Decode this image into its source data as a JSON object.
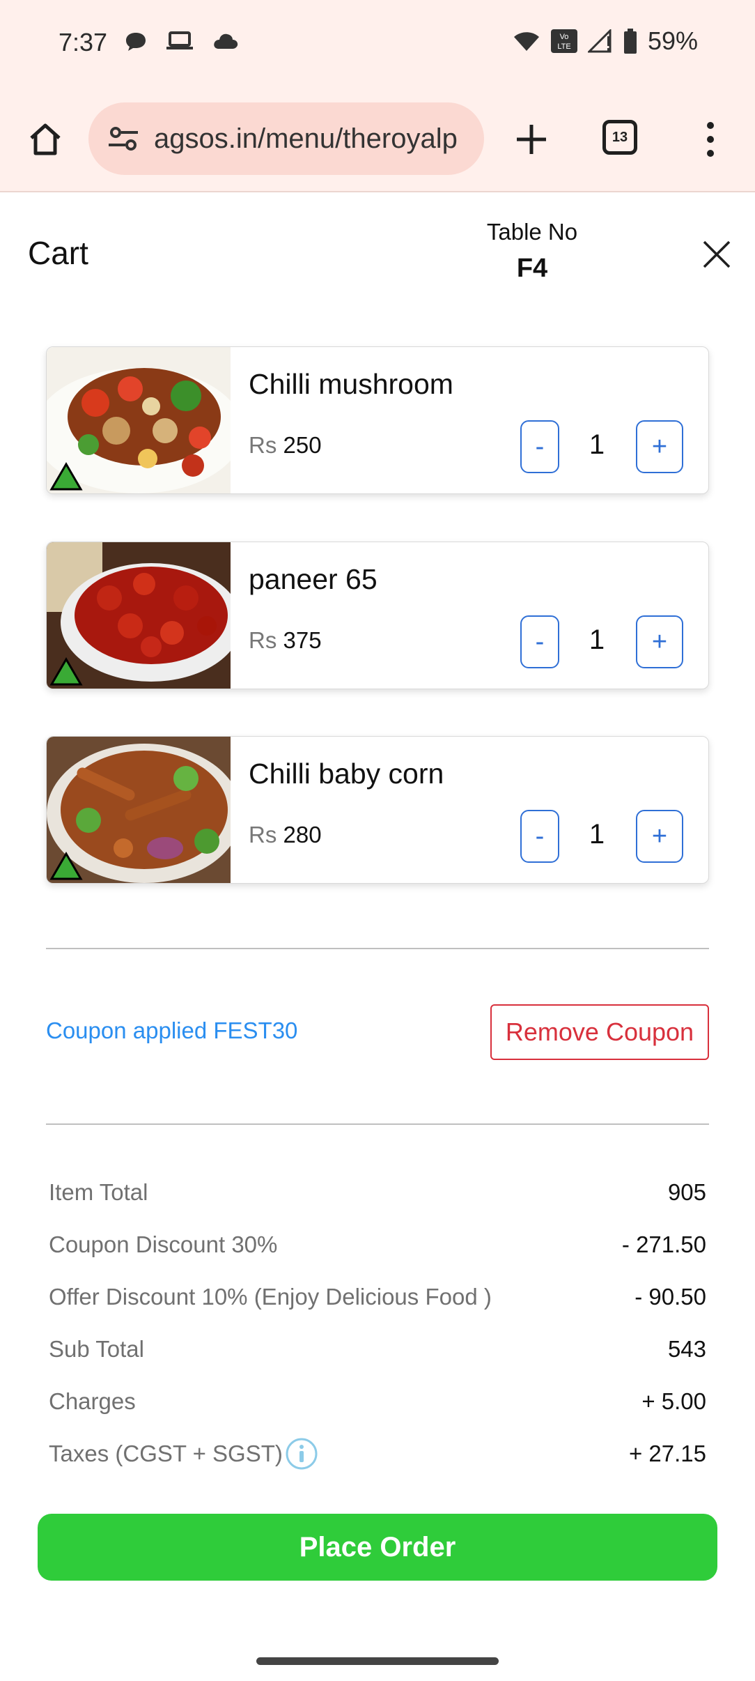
{
  "status_bar": {
    "time": "7:37",
    "left_icons": [
      "chat-bubble-icon",
      "laptop-icon",
      "cloud-icon"
    ],
    "right_icons": [
      "wifi-icon",
      "volte-icon",
      "signal-icon",
      "battery-icon"
    ],
    "battery": "59%"
  },
  "browser": {
    "url": "agsos.in/menu/theroyalp",
    "tab_count": "13"
  },
  "header": {
    "title": "Cart",
    "table_label": "Table No",
    "table_value": "F4"
  },
  "items": [
    {
      "name": "Chilli mushroom",
      "currency": "Rs",
      "price": "250",
      "quantity": "1",
      "minus": "-",
      "plus": "+",
      "veg": true
    },
    {
      "name": "paneer 65",
      "currency": "Rs",
      "price": "375",
      "quantity": "1",
      "minus": "-",
      "plus": "+",
      "veg": true
    },
    {
      "name": "Chilli baby corn",
      "currency": "Rs",
      "price": "280",
      "quantity": "1",
      "minus": "-",
      "plus": "+",
      "veg": true
    }
  ],
  "coupon": {
    "applied_text": "Coupon applied FEST30",
    "remove_label": "Remove Coupon"
  },
  "summary": [
    {
      "label": "Item Total",
      "value": "905"
    },
    {
      "label": "Coupon Discount 30%",
      "value": "- 271.50"
    },
    {
      "label": "Offer Discount 10% (Enjoy Delicious Food )",
      "value": "- 90.50"
    },
    {
      "label": "Sub Total",
      "value": "543"
    },
    {
      "label": "Charges",
      "value": "+ 5.00"
    },
    {
      "label": "Taxes (CGST + SGST)",
      "value": "+ 27.15"
    }
  ],
  "actions": {
    "place_order": "Place Order"
  },
  "colors": {
    "accent_blue": "#2f6fd6",
    "coupon_blue": "#2a8ef0",
    "remove_red": "#d8303c",
    "place_order_green": "#2fcc3a",
    "veg_green": "#3aaa35"
  }
}
